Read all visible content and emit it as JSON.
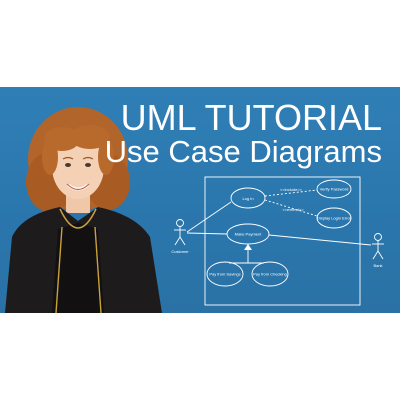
{
  "thumbnail": {
    "title_line1": "UML TUTORIAL",
    "title_line2": "Use Case Diagrams",
    "background_color": "#2f7fb6",
    "diagram": {
      "actor_left_label": "Customer",
      "actor_right_label": "Bank",
      "use_cases": [
        "Log In",
        "Verify Password",
        "Display Login Error",
        "Make Payment",
        "Pay from Savings",
        "Pay from Checking"
      ],
      "relation_labels": [
        "<<include>>",
        "<<extend>>"
      ]
    }
  }
}
